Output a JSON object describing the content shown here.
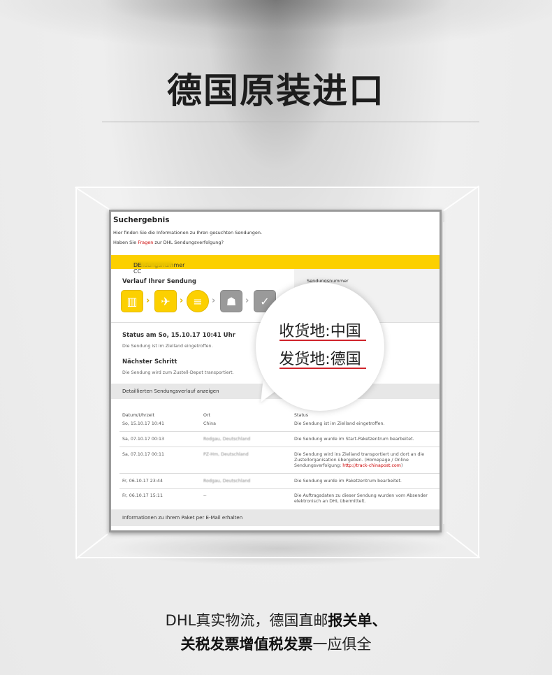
{
  "headline": "德国原装进口",
  "card": {
    "title": "Suchergebnis",
    "sub1": "Hier finden Sie die Informationen zu Ihren gesuchten Sendungen.",
    "sub2_pre": "Haben Sie ",
    "sub2_link": "Fragen",
    "sub2_post": " zur DHL Sendungsverfolgung?",
    "tracking_label": "Sendungsnummer CC",
    "tracking_suffix": "DE",
    "verlauf_title": "Verlauf Ihrer Sendung",
    "auftrag_label": "Sendungsnummer",
    "status_title": "Status am So, 15.10.17 10:41 Uhr",
    "status_desc": "Die Sendung ist im Zielland eingetroffen.",
    "next_title": "Nächster Schritt",
    "next_desc": "Die Sendung wird zum Zustell-Depot transportiert.",
    "detail_link": "Detaillierten Sendungsverlauf anzeigen",
    "columns": [
      "Datum/Uhrzeit",
      "Ort",
      "Status"
    ],
    "rows": [
      {
        "date": "So, 15.10.17 10:41",
        "place": "China",
        "status": "Die Sendung ist im Zielland eingetroffen."
      },
      {
        "date": "Sa, 07.10.17 00:13",
        "place": "Rodgau, Deutschland",
        "status": "Die Sendung wurde im Start-Paketzentrum bearbeitet."
      },
      {
        "date": "Sa, 07.10.17 00:11",
        "place": "PZ-Hm, Deutschland",
        "status": "Die Sendung wird ins Zielland transportiert und dort an die Zustellorganisation übergeben. (Homepage / Online Sendungsverfolgung: ",
        "link": "http://track-chinapost.com",
        "status_end": ")"
      },
      {
        "date": "Fr, 06.10.17 23:44",
        "place": "Rodgau, Deutschland",
        "status": "Die Sendung wurde im Paketzentrum bearbeitet."
      },
      {
        "date": "Fr, 06.10.17 15:11",
        "place": "--",
        "status": "Die Auftragsdaten zu dieser Sendung wurden vom Absender elektronisch an DHL übermittelt."
      }
    ],
    "email_bar": "Informationen zu Ihrem Paket per E-Mail erhalten"
  },
  "bubble": {
    "line1": "收货地:中国",
    "line2": "发货地:德国"
  },
  "bottom": {
    "line1_normal": "DHL真实物流，德国直邮",
    "line1_bold": "报关单、",
    "line2_bold": "关税发票增值税发票",
    "line2_normal": "一应俱全"
  },
  "colors": {
    "accent": "#fcd000",
    "underline": "#d0242b"
  }
}
